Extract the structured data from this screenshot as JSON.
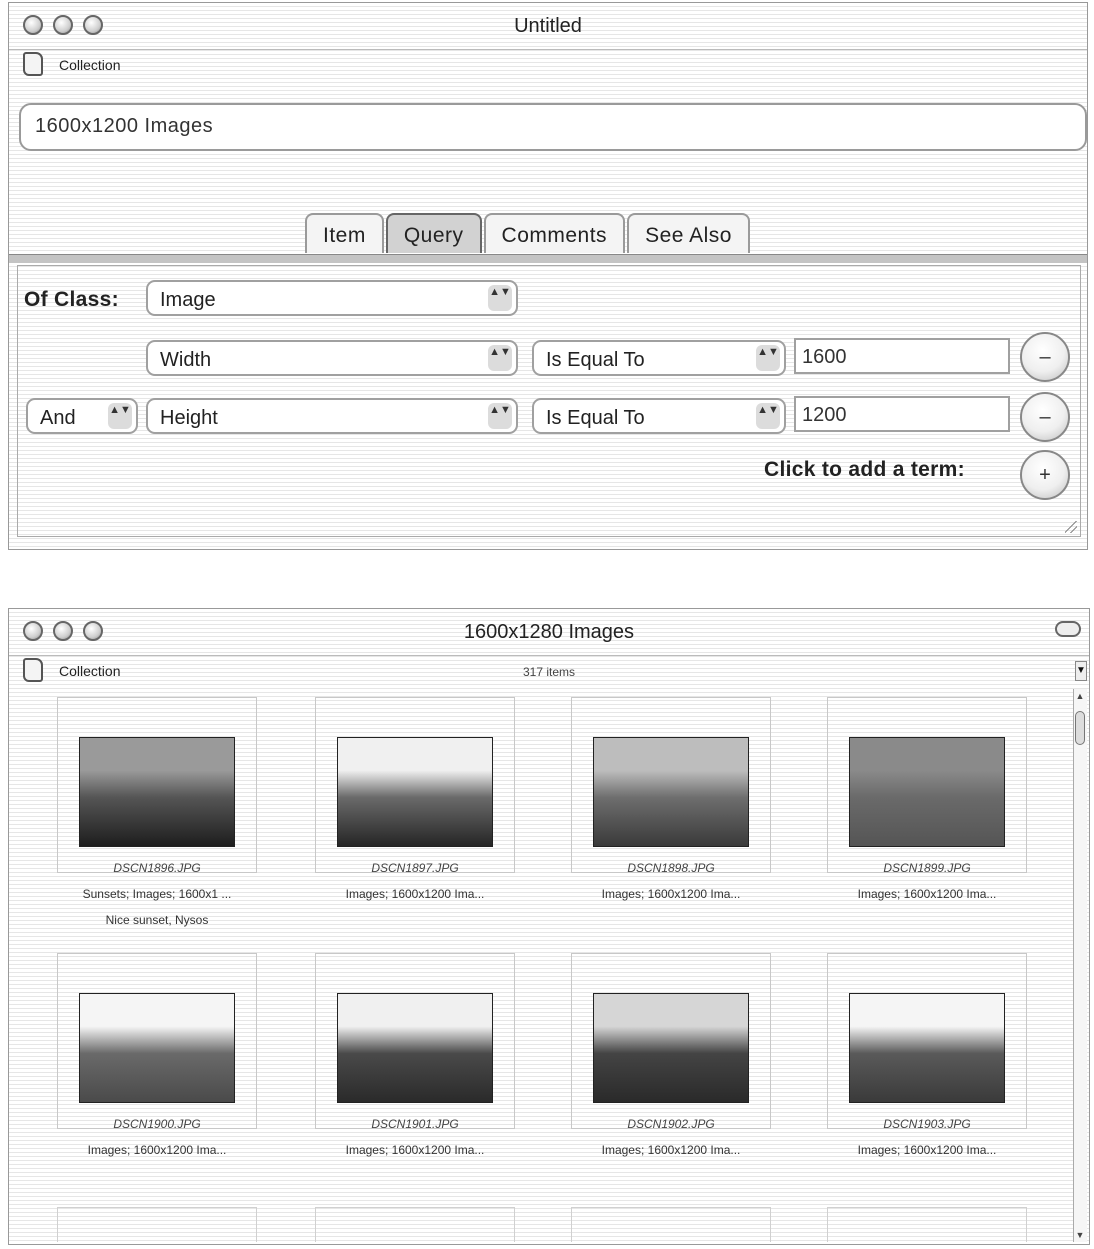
{
  "query_window": {
    "title": "Untitled",
    "toolbar_label": "Collection",
    "name_field": "1600x1200 Images",
    "tabs": [
      "Item",
      "Query",
      "Comments",
      "See Also"
    ],
    "active_tab": "Query",
    "of_class_label": "Of Class:",
    "class_value": "Image",
    "terms": [
      {
        "conjunction": "",
        "attribute": "Width",
        "operator": "Is Equal To",
        "value": "1600",
        "remove": "–"
      },
      {
        "conjunction": "And",
        "attribute": "Height",
        "operator": "Is Equal To",
        "value": "1200",
        "remove": "–"
      }
    ],
    "add_term_label": "Click to add a term:",
    "add_button": "+",
    "popup_arrows": "▲▼"
  },
  "results_window": {
    "title": "1600x1280 Images",
    "toolbar_label": "Collection",
    "item_count": "317 items",
    "items": [
      {
        "filename": "DSCN1896.JPG",
        "desc": "Sunsets; Images; 1600x1 ...",
        "note": "Nice sunset, Nysos",
        "tone": [
          "#9a9a9a",
          "#555",
          "#1e1e1e"
        ]
      },
      {
        "filename": "DSCN1897.JPG",
        "desc": "Images; 1600x1200 Ima...",
        "note": "",
        "tone": [
          "#f0f0f0",
          "#6a6a6a",
          "#262626"
        ]
      },
      {
        "filename": "DSCN1898.JPG",
        "desc": "Images; 1600x1200 Ima...",
        "note": "",
        "tone": [
          "#bdbdbd",
          "#6e6e6e",
          "#3a3a3a"
        ]
      },
      {
        "filename": "DSCN1899.JPG",
        "desc": "Images; 1600x1200 Ima...",
        "note": "",
        "tone": [
          "#8a8a8a",
          "#6a6a6a",
          "#555"
        ]
      },
      {
        "filename": "DSCN1900.JPG",
        "desc": "Images; 1600x1200 Ima...",
        "note": "",
        "tone": [
          "#f5f5f5",
          "#6a6a6a",
          "#4a4a4a"
        ]
      },
      {
        "filename": "DSCN1901.JPG",
        "desc": "Images; 1600x1200 Ima...",
        "note": "",
        "tone": [
          "#f0f0f0",
          "#4a4a4a",
          "#2a2a2a"
        ]
      },
      {
        "filename": "DSCN1902.JPG",
        "desc": "Images; 1600x1200 Ima...",
        "note": "",
        "tone": [
          "#d6d6d6",
          "#444",
          "#2a2a2a"
        ]
      },
      {
        "filename": "DSCN1903.JPG",
        "desc": "Images; 1600x1200 Ima...",
        "note": "",
        "tone": [
          "#f5f5f5",
          "#5a5a5a",
          "#3a3a3a"
        ]
      }
    ],
    "scroll_up": "▲",
    "scroll_down": "▼",
    "toolbar_scroll": "▼"
  }
}
